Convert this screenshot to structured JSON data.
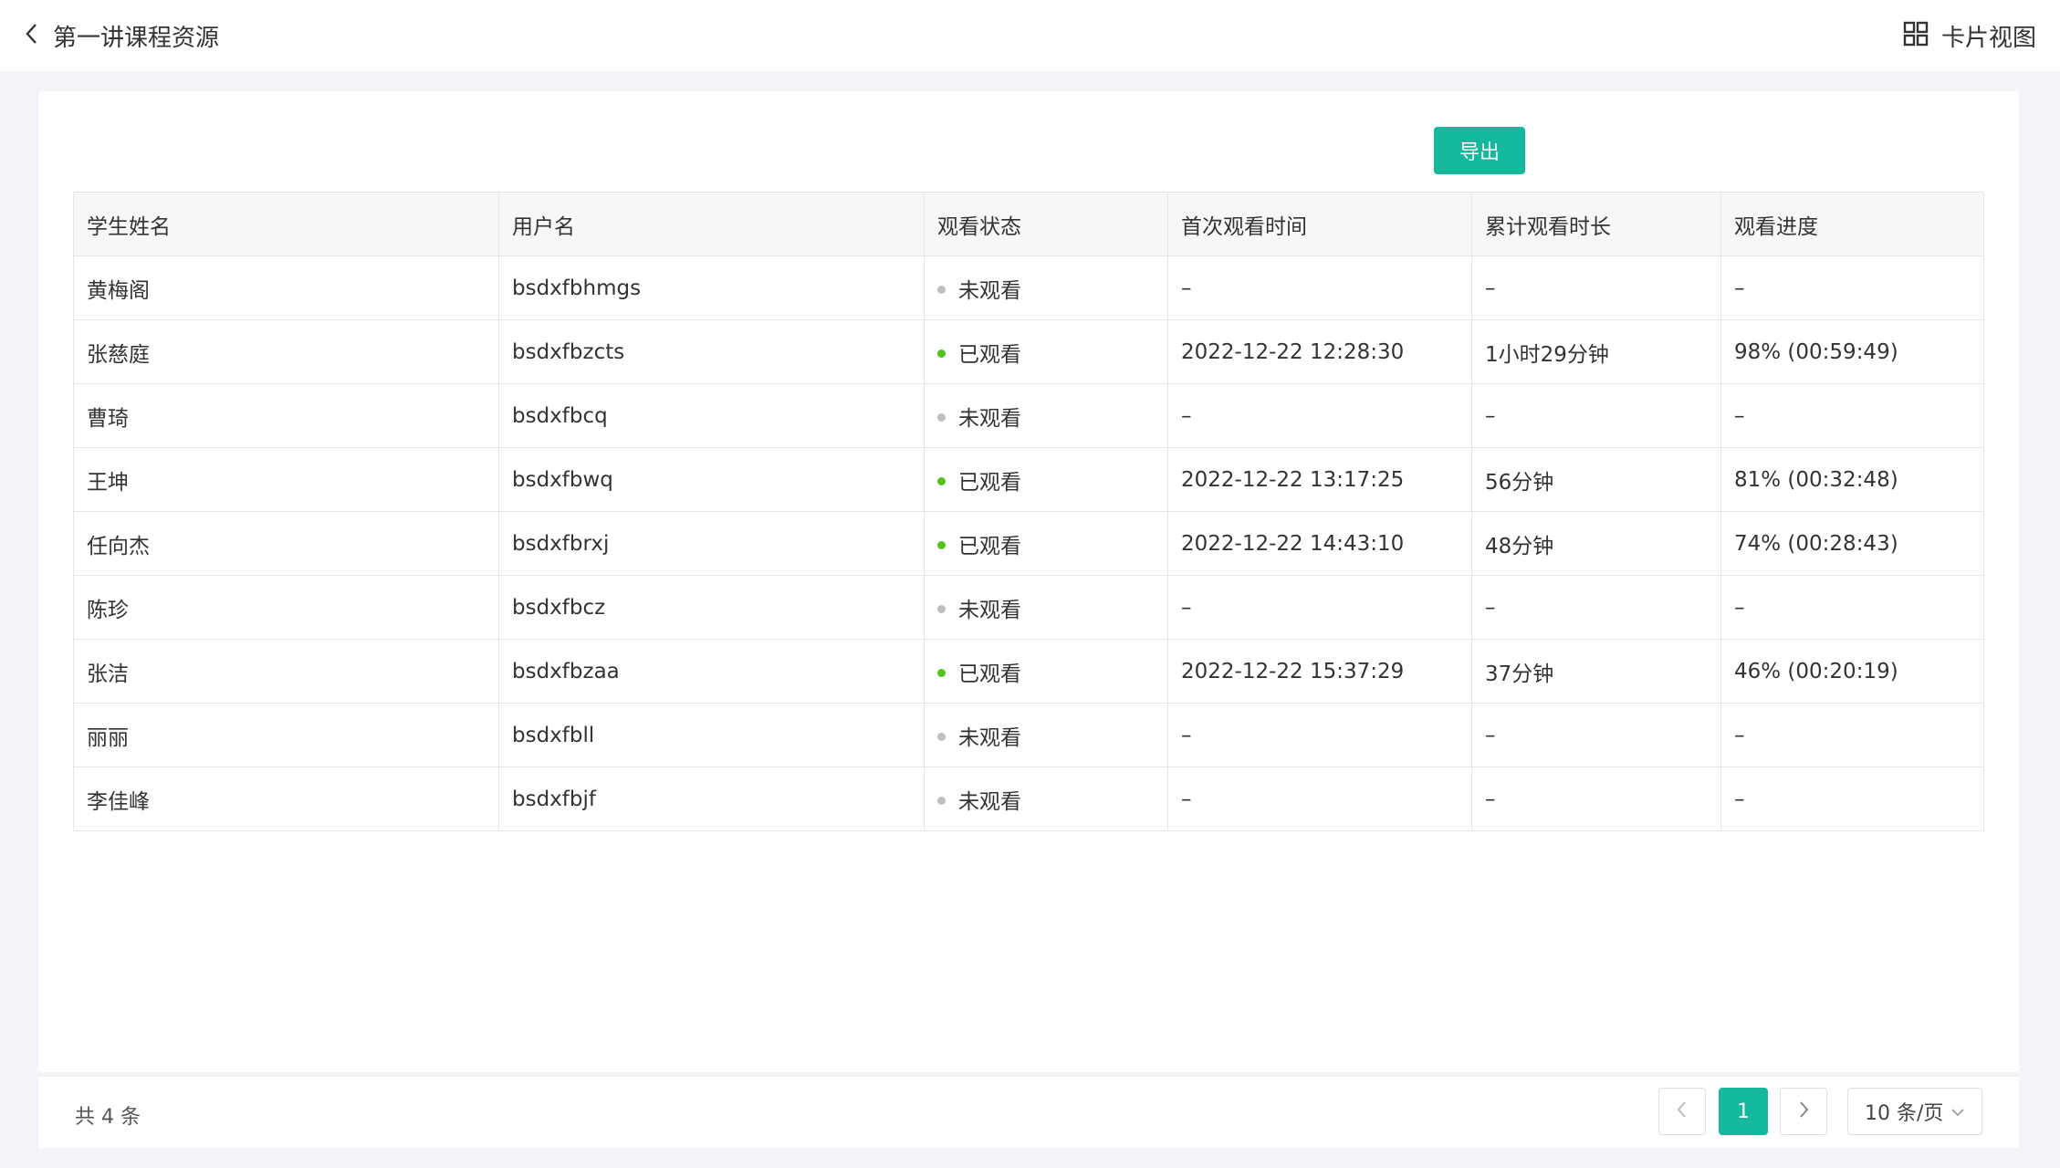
{
  "header": {
    "title": "第一讲课程资源",
    "view_toggle_label": "卡片视图"
  },
  "toolbar": {
    "export_label": "导出"
  },
  "table": {
    "columns": [
      "学生姓名",
      "用户名",
      "观看状态",
      "首次观看时间",
      "累计观看时长",
      "观看进度"
    ],
    "rows": [
      {
        "name": "黄梅阁",
        "username": "bsdxfbhmgs",
        "status": "未观看",
        "watched": false,
        "first_time": "–",
        "duration": "–",
        "progress": "–"
      },
      {
        "name": "张慈庭",
        "username": "bsdxfbzcts",
        "status": "已观看",
        "watched": true,
        "first_time": "2022-12-22  12:28:30",
        "duration": "1小时29分钟",
        "progress": "98% (00:59:49)"
      },
      {
        "name": "曹琦",
        "username": "bsdxfbcq",
        "status": "未观看",
        "watched": false,
        "first_time": "–",
        "duration": "–",
        "progress": "–"
      },
      {
        "name": "王坤",
        "username": "bsdxfbwq",
        "status": "已观看",
        "watched": true,
        "first_time": "2022-12-22  13:17:25",
        "duration": "56分钟",
        "progress": "81% (00:32:48)"
      },
      {
        "name": "任向杰",
        "username": "bsdxfbrxj",
        "status": "已观看",
        "watched": true,
        "first_time": "2022-12-22  14:43:10",
        "duration": "48分钟",
        "progress": "74% (00:28:43)"
      },
      {
        "name": "陈珍",
        "username": "bsdxfbcz",
        "status": "未观看",
        "watched": false,
        "first_time": "–",
        "duration": "–",
        "progress": "–"
      },
      {
        "name": "张洁",
        "username": "bsdxfbzaa",
        "status": "已观看",
        "watched": true,
        "first_time": "2022-12-22  15:37:29",
        "duration": "37分钟",
        "progress": "46% (00:20:19)"
      },
      {
        "name": "丽丽",
        "username": "bsdxfbll",
        "status": "未观看",
        "watched": false,
        "first_time": "–",
        "duration": "–",
        "progress": "–"
      },
      {
        "name": "李佳峰",
        "username": "bsdxfbjf",
        "status": "未观看",
        "watched": false,
        "first_time": "–",
        "duration": "–",
        "progress": "–"
      }
    ]
  },
  "pagination": {
    "total_text": "共 4 条",
    "current_page": "1",
    "page_size": "10 条/页"
  },
  "colors": {
    "accent": "#14b89c",
    "watched_dot": "#52c41a",
    "unwatched_dot": "#bfbfbf"
  }
}
